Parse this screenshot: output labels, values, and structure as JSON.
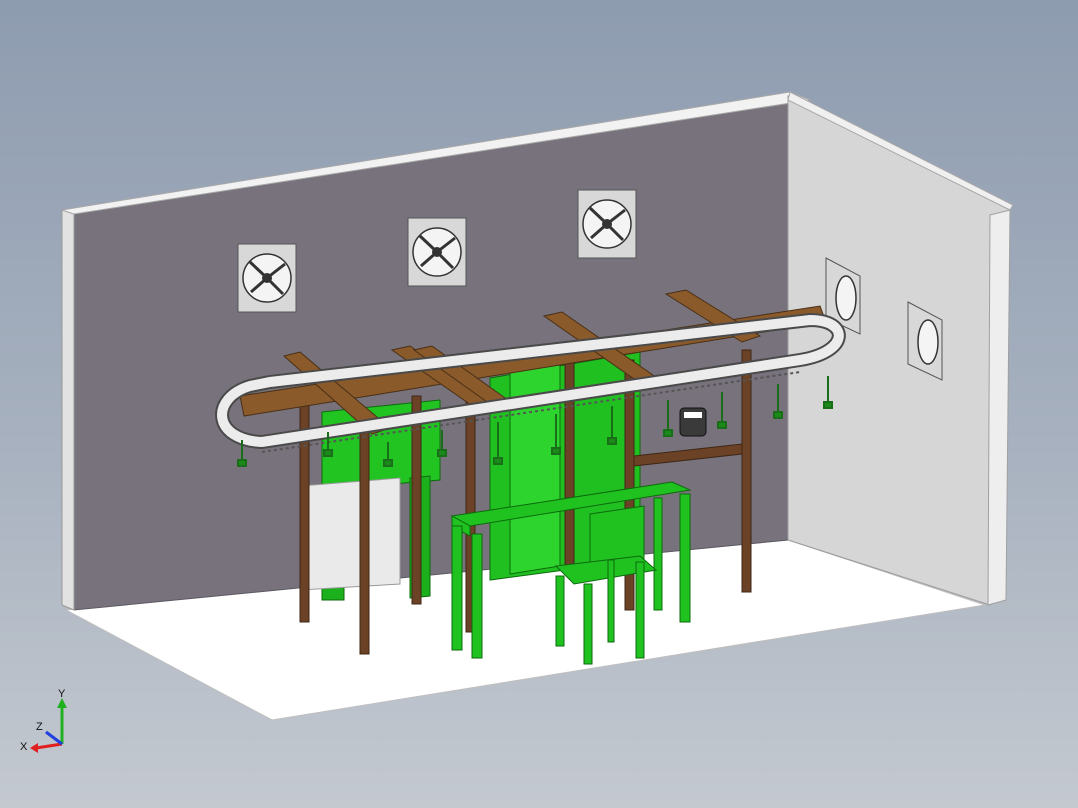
{
  "viewport": {
    "background_top": "#8e9cb0",
    "background_bottom": "#c4c9d0"
  },
  "scene": {
    "model": "room-with-overhead-conveyor",
    "colors": {
      "floor": "#ffffff",
      "back_wall": "#7b7780",
      "right_wall": "#d3d3d3",
      "wall_edge": "#ececec",
      "beam": "#8a5a2b",
      "post": "#6b4226",
      "conveyor_rail": "#e6e6e6",
      "green_machine": "#1fc21f",
      "green_dark": "#108010"
    },
    "icons": [
      "window-fan-icon",
      "conveyor-motor-icon"
    ]
  },
  "triad": {
    "x_label": "X",
    "y_label": "Y",
    "z_label": "Z",
    "x_color": "#e02020",
    "y_color": "#20b020",
    "z_color": "#2040e0"
  }
}
